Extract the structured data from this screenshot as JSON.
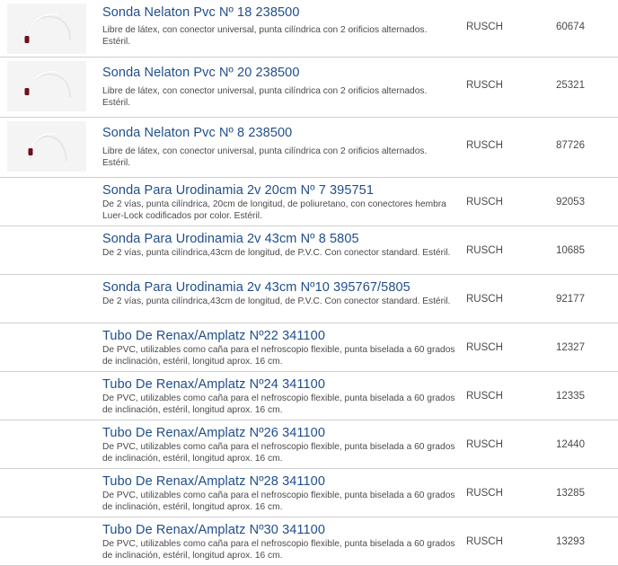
{
  "products": [
    {
      "title": "Sonda Nelaton Pvc Nº 18 238500",
      "desc": "Libre de látex, con conector universal, punta cilíndrica con 2 orificios alternados. Estéril.",
      "brand": "RUSCH",
      "code": "60674"
    },
    {
      "title": "Sonda Nelaton Pvc Nº 20 238500",
      "desc": "Libre de látex, con conector universal, punta cilíndrica con 2 orificios alternados. Estéril.",
      "brand": "RUSCH",
      "code": "25321"
    },
    {
      "title": "Sonda Nelaton Pvc Nº 8 238500",
      "desc": "Libre de látex, con conector universal, punta cilíndrica con 2 orificios alternados. Estéril.",
      "brand": "RUSCH",
      "code": "87726"
    },
    {
      "title": "Sonda Para Urodinamia 2v 20cm Nº 7 395751",
      "desc": "De 2 vías, punta cilíndrica, 20cm de longitud, de poliuretano, con conectores hembra Luer-Lock codificados por color. Estéril.",
      "brand": "RUSCH",
      "code": "92053"
    },
    {
      "title": "Sonda Para Urodinamia 2v 43cm Nº 8 5805",
      "desc": "De 2 vías, punta cilíndrica,43cm de longitud, de P.V.C. Con conector standard. Estéril.",
      "brand": "RUSCH",
      "code": "10685"
    },
    {
      "title": "Sonda Para Urodinamia 2v 43cm Nº10 395767/5805",
      "desc": "De 2 vías, punta cilíndrica,43cm de longitud, de P.V.C. Con conector standard. Estéril.",
      "brand": "RUSCH",
      "code": "92177"
    },
    {
      "title": "Tubo De Renax/Amplatz Nº22 341100",
      "desc": "De PVC, utilizables como caña para el nefroscopio flexible, punta biselada a 60 grados de inclinación, estéril, longitud aprox. 16 cm.",
      "brand": "RUSCH",
      "code": "12327"
    },
    {
      "title": "Tubo De Renax/Amplatz Nº24 341100",
      "desc": "De PVC, utilizables como caña para el nefroscopio flexible, punta biselada a 60 grados de inclinación, estéril, longitud aprox. 16 cm.",
      "brand": "RUSCH",
      "code": "12335"
    },
    {
      "title": "Tubo De Renax/Amplatz Nº26 341100",
      "desc": "De PVC, utilizables como caña para el nefroscopio flexible, punta biselada a 60 grados de inclinación, estéril, longitud aprox. 16 cm.",
      "brand": "RUSCH",
      "code": "12440"
    },
    {
      "title": "Tubo De Renax/Amplatz Nº28 341100",
      "desc": "De PVC, utilizables como caña para el nefroscopio flexible, punta biselada a 60 grados de inclinación, estéril, longitud aprox. 16 cm.",
      "brand": "RUSCH",
      "code": "13285"
    },
    {
      "title": "Tubo De Renax/Amplatz Nº30 341100",
      "desc": "De PVC, utilizables como caña para el nefroscopio flexible, punta biselada a 60 grados de inclinación, estéril, longitud aprox. 16 cm.",
      "brand": "RUSCH",
      "code": "13293"
    }
  ],
  "colors": {
    "title": "#1f4e8c",
    "text": "#4a4a4a",
    "divider": "#cfcfcf"
  },
  "icons": {
    "thumbnail": "catheter-thumbnail-icon"
  }
}
